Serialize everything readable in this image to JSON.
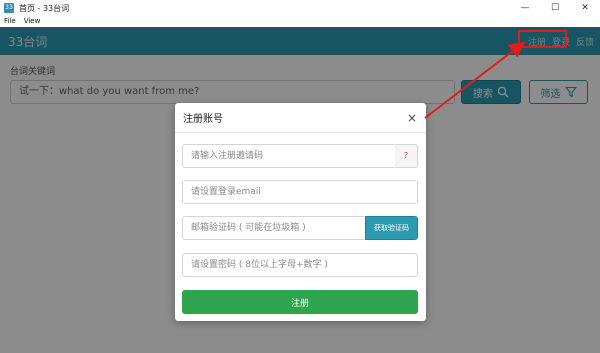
{
  "window": {
    "title": "首页 - 33台词",
    "icon_label": "33",
    "minimize_glyph": "—",
    "maximize_glyph": "☐",
    "close_glyph": "✕"
  },
  "menu": {
    "items": [
      "File",
      "View"
    ]
  },
  "header": {
    "brand": "33台词",
    "links": [
      "注册",
      "登录",
      "反馈"
    ],
    "color": "#2b9bb2"
  },
  "search": {
    "label": "台词关键词",
    "value": "试一下：what do you want from me?",
    "search_label": "搜索",
    "filter_label": "筛选"
  },
  "modal": {
    "title": "注册账号",
    "close_glyph": "×",
    "invite_placeholder": "请输入注册邀请码",
    "invite_help": "?",
    "email_placeholder": "请设置登录email",
    "code_placeholder": "邮箱验证码 ( 可能在垃圾箱 )",
    "code_button": "获取验证码",
    "password_placeholder": "请设置密码 ( 8位以上字母+数字 )",
    "register_button": "注册",
    "register_color": "#2ea44f"
  },
  "annotation": {
    "color": "#e21b1b"
  }
}
